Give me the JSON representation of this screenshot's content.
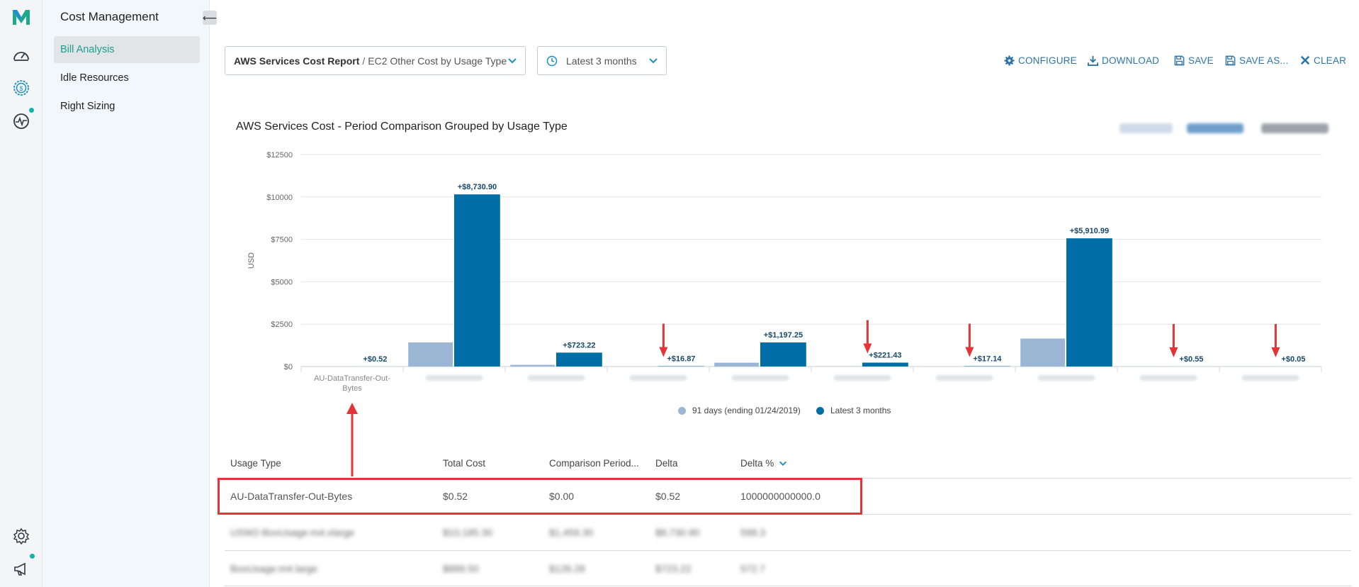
{
  "app": {
    "brand_icon": "m-logo-icon",
    "accent": "#1a9e8f",
    "link_color": "#2e74a5"
  },
  "nav": {
    "title": "Cost Management",
    "collapse_glyph": "⟵",
    "items": [
      {
        "label": "Bill Analysis",
        "active": true
      },
      {
        "label": "Idle Resources",
        "active": false
      },
      {
        "label": "Right Sizing",
        "active": false
      }
    ]
  },
  "toolbar": {
    "report": "AWS Services Cost Report",
    "report_separator": "/",
    "subreport": "EC2 Other Cost by Usage Type",
    "period": "Latest 3 months",
    "actions": {
      "configure": "CONFIGURE",
      "download": "DOWNLOAD",
      "save": "SAVE",
      "save_as": "SAVE AS...",
      "clear": "CLEAR"
    }
  },
  "chart_data": {
    "type": "bar",
    "title": "AWS Services Cost - Period Comparison Grouped by Usage Type",
    "ylabel": "USD",
    "ylim": [
      0,
      12500
    ],
    "yticks": [
      "$0",
      "$2500",
      "$5000",
      "$7500",
      "$10000",
      "$12500"
    ],
    "ytick_values": [
      0,
      2500,
      5000,
      7500,
      10000,
      12500
    ],
    "categories": [
      "AU-DataTransfer-Out-Bytes",
      "",
      "",
      "",
      "",
      "",
      "",
      "",
      "",
      ""
    ],
    "series": [
      {
        "name": "91 days (ending 01/24/2019)",
        "color": "#9cb6d6",
        "values": [
          0,
          1420,
          100,
          0,
          225,
          10,
          5,
          1650,
          1,
          1
        ]
      },
      {
        "name": "Latest 3 months",
        "color": "#006ea6",
        "values": [
          1,
          10150,
          820,
          20,
          1420,
          230,
          20,
          7560,
          1,
          1
        ]
      }
    ],
    "delta_labels": [
      "+$0.52",
      "+$8,730.90",
      "+$723.22",
      "+$16.87",
      "+$1,197.25",
      "+$221.43",
      "+$17.14",
      "+$5,910.99",
      "+$0.55",
      "+$0.05"
    ],
    "arrows_at": [
      3,
      5,
      6,
      8,
      9
    ],
    "legend_position": "bottom-center",
    "grid": true
  },
  "table": {
    "columns": [
      "Usage Type",
      "Total Cost",
      "Comparison Period...",
      "Delta",
      "Delta %"
    ],
    "sort_icon": "chevron-down-icon",
    "rows": [
      [
        "AU-DataTransfer-Out-Bytes",
        "$0.52",
        "$0.00",
        "$0.52",
        "1000000000000.0"
      ],
      [
        "USW2-BoxUsage:m4.xlarge",
        "$10,185.30",
        "$1,459.30",
        "$8,730.90",
        "598.3"
      ],
      [
        "BoxUsage:m4.large",
        "$889.50",
        "$126.28",
        "$723.22",
        "572.7"
      ]
    ]
  }
}
